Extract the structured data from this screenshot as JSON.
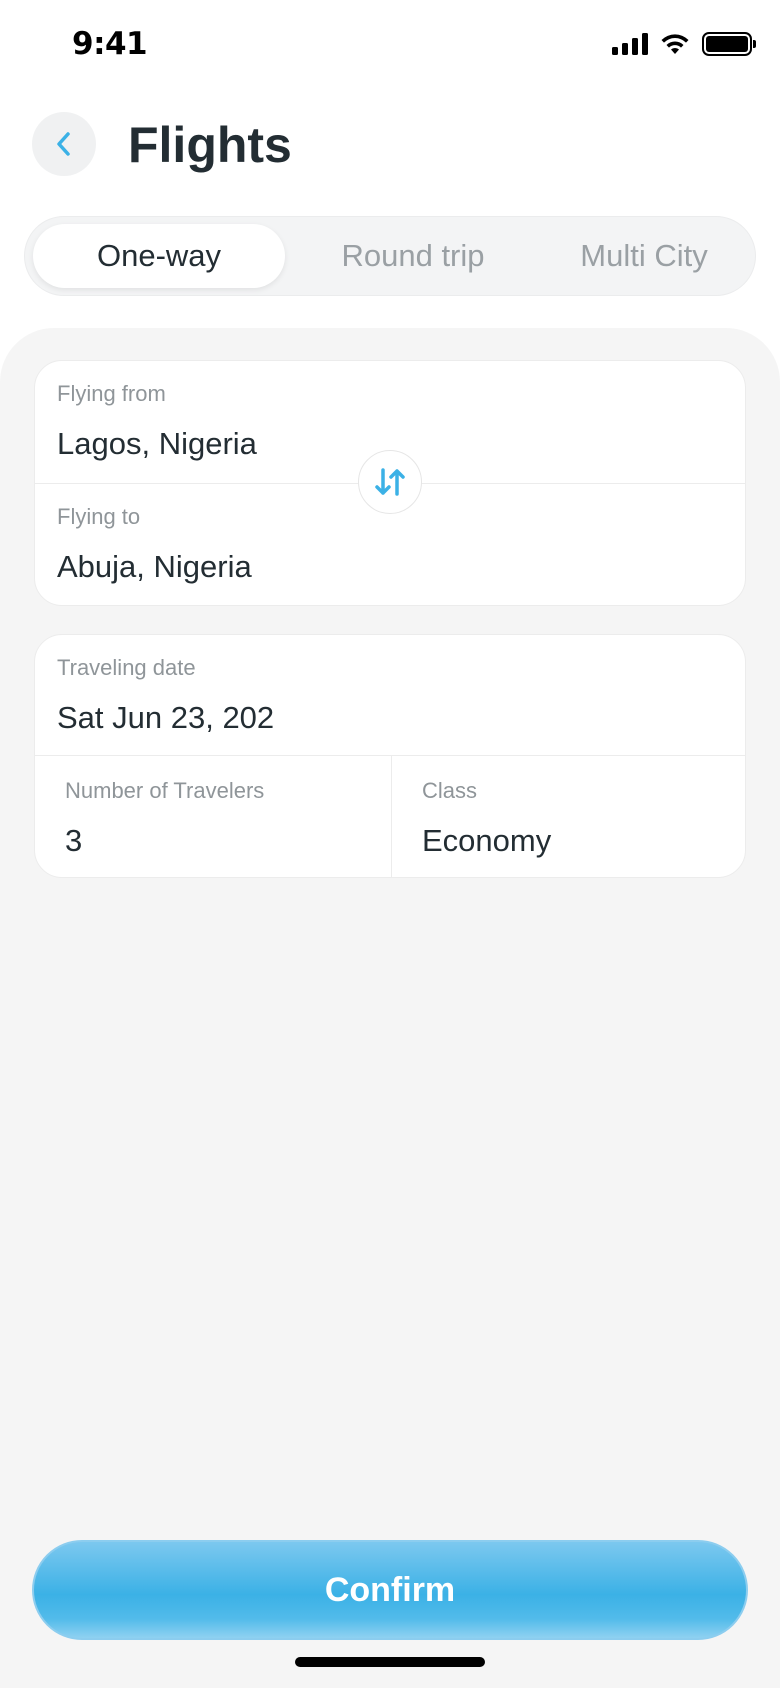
{
  "status_bar": {
    "time": "9:41"
  },
  "header": {
    "title": "Flights"
  },
  "trip_types": [
    {
      "label": "One-way",
      "active": true
    },
    {
      "label": "Round trip",
      "active": false
    },
    {
      "label": "Multi City",
      "active": false
    }
  ],
  "route": {
    "from": {
      "label": "Flying from",
      "value": "Lagos, Nigeria"
    },
    "to": {
      "label": "Flying to",
      "value": "Abuja, Nigeria"
    }
  },
  "details": {
    "date": {
      "label": "Traveling date",
      "value": "Sat Jun 23, 202"
    },
    "travelers": {
      "label": "Number of Travelers",
      "value": "3"
    },
    "class": {
      "label": "Class",
      "value": "Economy"
    }
  },
  "actions": {
    "confirm_label": "Confirm"
  },
  "colors": {
    "accent": "#3bb1e6",
    "text": "#232d33",
    "muted": "#8f9599",
    "background": "#f5f5f5"
  },
  "icons": {
    "back": "chevron-left-icon",
    "swap": "swap-vertical-icon"
  }
}
